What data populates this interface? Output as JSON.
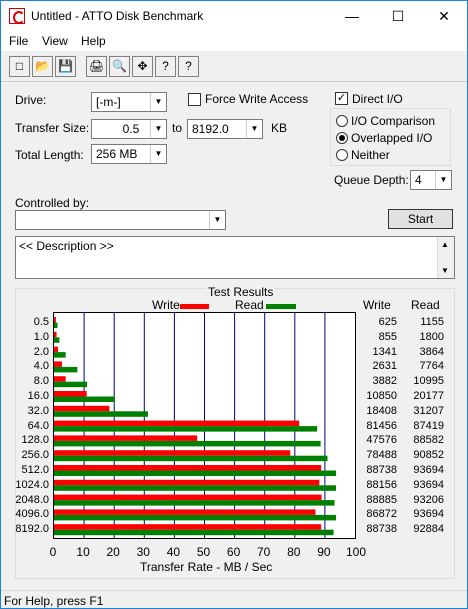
{
  "window": {
    "title": "Untitled - ATTO Disk Benchmark",
    "minimize": "—",
    "maximize": "☐",
    "close": "✕"
  },
  "menu": {
    "file": "File",
    "view": "View",
    "help": "Help"
  },
  "toolbar": {
    "new": "□",
    "open": "📂",
    "save": "💾",
    "print": "🖨",
    "preview": "🔍",
    "move": "✥",
    "help": "?",
    "context_help": "?"
  },
  "form": {
    "drive_label": "Drive:",
    "drive_value": "[-m-]",
    "transfer_label": "Transfer Size:",
    "transfer_from": "0.5",
    "to_label": "to",
    "transfer_to": "8192.0",
    "kb": "KB",
    "total_label": "Total Length:",
    "total_value": "256 MB",
    "force_write": "Force Write Access",
    "direct_io": "Direct I/O",
    "io_comparison": "I/O Comparison",
    "overlapped_io": "Overlapped I/O",
    "neither": "Neither",
    "queue_label": "Queue Depth:",
    "queue_value": "4",
    "controlled_label": "Controlled by:",
    "controlled_value": "",
    "start": "Start",
    "description": "<< Description >>"
  },
  "status": "For Help, press F1",
  "chart_data": {
    "type": "bar",
    "title": "Test Results",
    "xlabel": "Transfer Rate - MB / Sec",
    "ylabel": "",
    "xlim": [
      0,
      100
    ],
    "x_ticks": [
      "0",
      "10",
      "20",
      "30",
      "40",
      "50",
      "60",
      "70",
      "80",
      "90",
      "100"
    ],
    "categories": [
      "0.5",
      "1.0",
      "2.0",
      "4.0",
      "8.0",
      "16.0",
      "32.0",
      "64.0",
      "128.0",
      "256.0",
      "512.0",
      "1024.0",
      "2048.0",
      "4096.0",
      "8192.0"
    ],
    "series": [
      {
        "name": "Write",
        "color": "#ff0000",
        "values": [
          625,
          855,
          1341,
          2631,
          3882,
          10850,
          18408,
          81456,
          47576,
          78488,
          88738,
          88156,
          88885,
          86872,
          88738
        ]
      },
      {
        "name": "Read",
        "color": "#008000",
        "values": [
          1155,
          1800,
          3864,
          7764,
          10995,
          20177,
          31207,
          87419,
          88582,
          90852,
          93694,
          93694,
          93206,
          93694,
          92884
        ]
      }
    ],
    "column_headers": [
      "Write",
      "Read"
    ]
  }
}
